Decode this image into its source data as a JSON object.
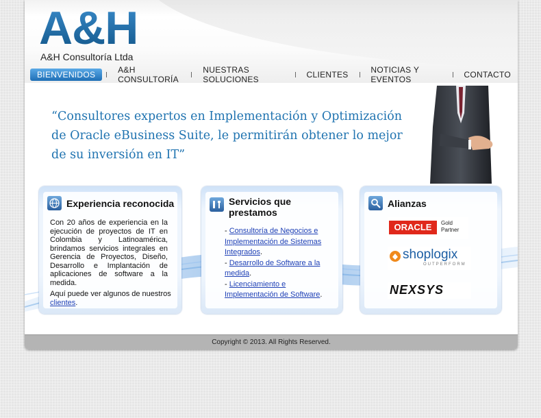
{
  "header": {
    "logo_mark": "A&H",
    "logo_sub": "A&H Consultoría Ltda"
  },
  "nav": {
    "items": [
      {
        "label": "BIENVENIDOS",
        "active": true
      },
      {
        "label": "A&H CONSULTORÍA"
      },
      {
        "label": "NUESTRAS SOLUCIONES"
      },
      {
        "label": "CLIENTES"
      },
      {
        "label": "NOTICIAS Y EVENTOS"
      },
      {
        "label": "CONTACTO"
      }
    ]
  },
  "hero": {
    "quote": "“Consultores expertos en Implementación y Optimización de Oracle eBusiness Suite, le permitirán obtener lo mejor de su inversión en IT”"
  },
  "boxes": {
    "experience": {
      "title": "Experiencia reconocida",
      "body": "Con 20 años de experiencia en la ejecución de proyectos de IT en Colombia y Latinoamérica, brindamos servicios integrales en Gerencia de Proyectos, Diseño, Desarrollo e Implantación de aplicaciones de software a la medida.",
      "clients_prefix": "Aquí puede ver algunos de nuestros",
      "clients_link": "clientes",
      "clients_suffix": ".",
      "icon": "globe-icon"
    },
    "services": {
      "title_line1": "Servicios que",
      "title_line2": "prestamos",
      "items": [
        {
          "link": "Consultoría de Negocios e Implementación de Sistemas Integrados"
        },
        {
          "link": "Desarrollo de Software a la medida"
        },
        {
          "link": "Licenciamiento e Implementación de Software"
        }
      ],
      "icon": "tools-icon"
    },
    "alliances": {
      "title": "Alianzas",
      "partners": [
        {
          "name": "ORACLE",
          "badge_line1": "Gold",
          "badge_line2": "Partner"
        },
        {
          "name": "shoplogix",
          "tagline": "OUTPERFORM"
        },
        {
          "name": "NEXSYS"
        }
      ],
      "icon": "magnifier-icon"
    }
  },
  "footer": {
    "copyright": "Copyright © 2013. All Rights Reserved."
  },
  "colors": {
    "brand_blue": "#1f73b0",
    "nav_active": "#2b7ac2",
    "link": "#1d3fb5",
    "oracle_red": "#e0281b",
    "shoplogix_orange": "#f08a1c"
  }
}
